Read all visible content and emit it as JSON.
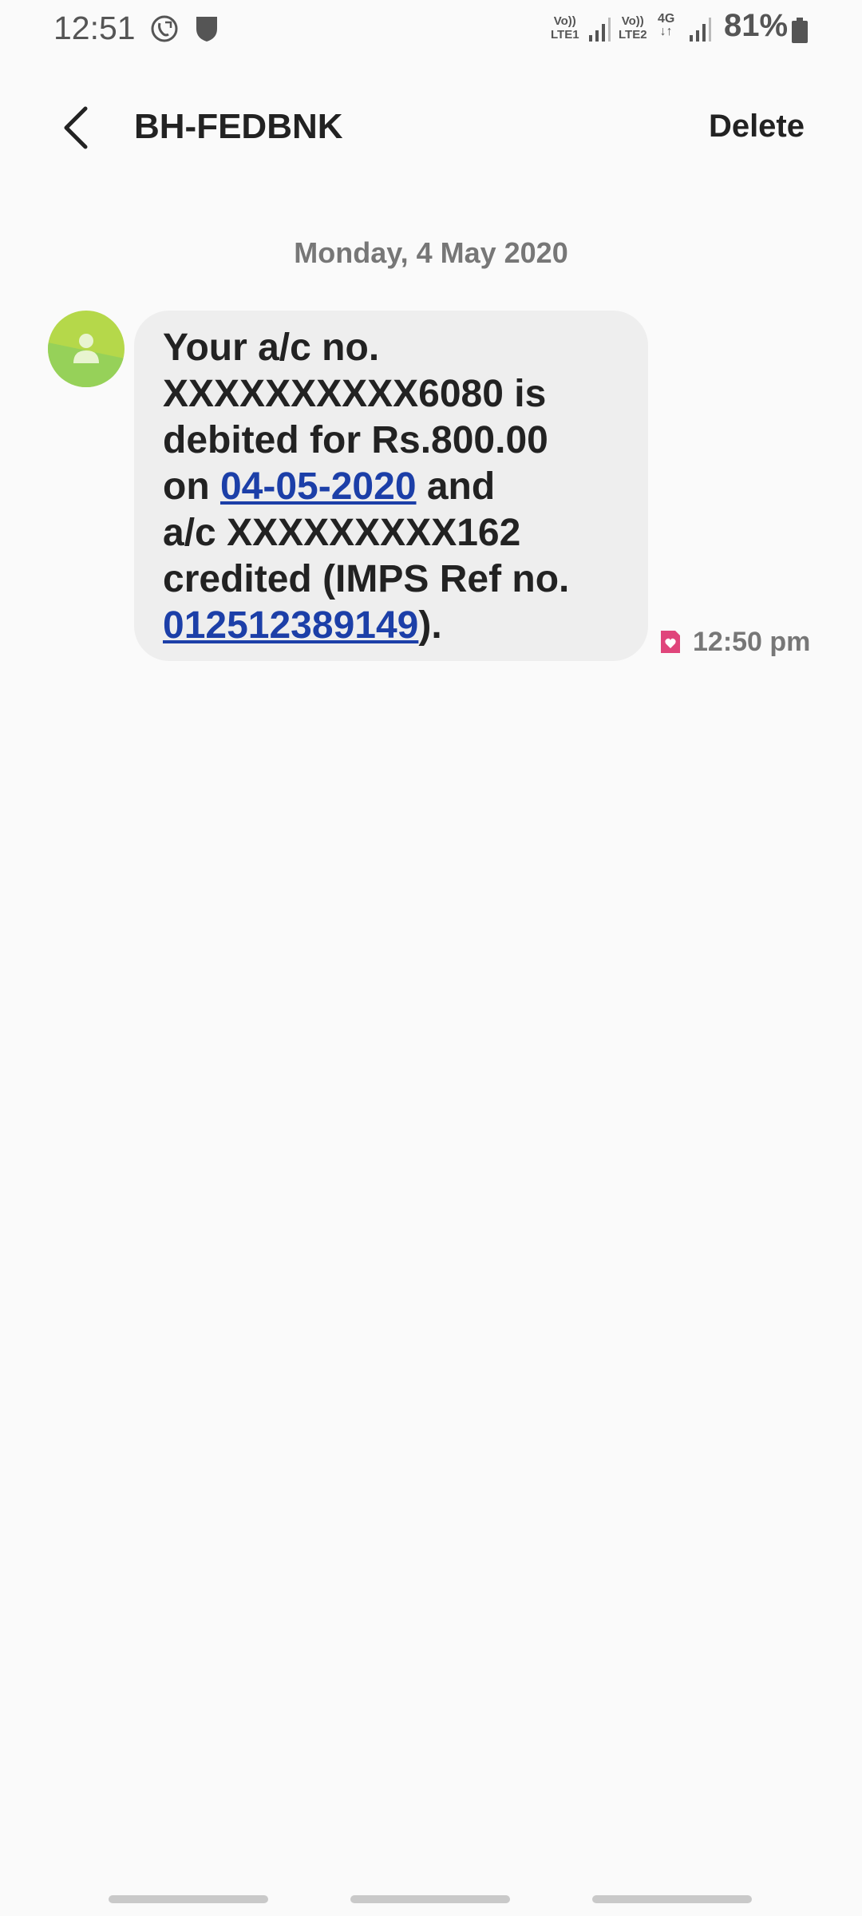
{
  "status_bar": {
    "time": "12:51",
    "sim1_label_top": "Vo))",
    "sim1_label_bottom": "LTE1",
    "sim2_label_top": "Vo))",
    "sim2_label_bottom": "LTE2",
    "network_type": "4G",
    "battery_percent": "81%"
  },
  "header": {
    "title": "BH-FEDBNK",
    "delete_label": "Delete"
  },
  "conversation": {
    "date_separator": "Monday, 4 May 2020",
    "message": {
      "text_part1": "Your a/c no.\nXXXXXXXXXX6080 is\ndebited for Rs.800.00\non ",
      "link_date": "04-05-2020",
      "text_part2": " and\na/c XXXXXXXXX162\ncredited (IMPS Ref no.\n",
      "link_ref": "012512389149",
      "text_part3": ").",
      "time": "12:50 pm"
    }
  },
  "colors": {
    "background": "#fafafa",
    "bubble": "#eeeeee",
    "link": "#1c3fa8",
    "avatar_green": "#9ed158",
    "sim_badge": "#e0457b"
  }
}
